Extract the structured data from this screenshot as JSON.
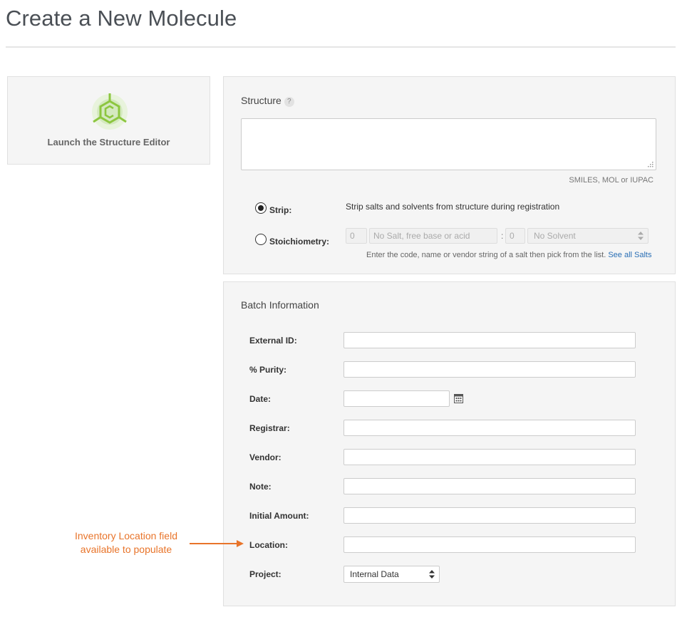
{
  "page": {
    "title": "Create a New Molecule"
  },
  "launch": {
    "label": "Launch the Structure Editor"
  },
  "structure": {
    "title": "Structure",
    "help": "?",
    "hint": "SMILES, MOL or IUPAC",
    "strip": {
      "label": "Strip:",
      "description": "Strip salts and solvents from structure during registration",
      "checked": true
    },
    "stoichiometry": {
      "label": "Stoichiometry:",
      "salt_count": "0",
      "salt_placeholder": "No Salt, free base or acid",
      "separator": ":",
      "solvent_count": "0",
      "solvent_value": "No Solvent",
      "help_text": "Enter the code, name or vendor string of a salt then pick from the list.",
      "see_all_link": "See all Salts",
      "checked": false
    }
  },
  "batch": {
    "title": "Batch Information",
    "fields": {
      "external_id": "External ID:",
      "purity": "% Purity:",
      "date": "Date:",
      "registrar": "Registrar:",
      "vendor": "Vendor:",
      "note": "Note:",
      "initial_amount": "Initial Amount:",
      "location": "Location:",
      "project": "Project:"
    },
    "project_value": "Internal Data"
  },
  "annotation": {
    "line1": "Inventory Location field",
    "line2": "available to populate",
    "color": "#e8742a"
  },
  "icons": {
    "launch": "structure-editor-icon",
    "calendar": "calendar-icon",
    "resize": "resize-handle-icon"
  },
  "colors": {
    "accent_green": "#8cc63f",
    "link": "#2a6fb5",
    "panel_bg": "#f5f5f5"
  }
}
